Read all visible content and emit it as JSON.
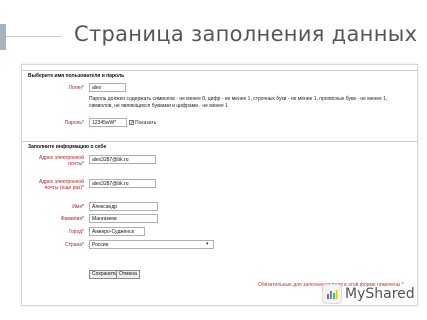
{
  "slide": {
    "title": "Страница заполнения данных"
  },
  "section_login": {
    "legend": "Выберите имя пользователя и пароль",
    "login_label": "Логин",
    "login_value": "alex",
    "hint_lines": [
      "Пароль должен содержать символов - не менее 8, цифр - не менее 1, строчных букв - не менее 1, прописных букв - не менее 1,",
      "символов, не являющихся буквами и цифрами - не менее 1"
    ],
    "password_label": "Пароль",
    "password_value": "12345wW*",
    "show_checkbox_label": "Показать",
    "show_checked": true
  },
  "section_info": {
    "legend": "Заполните информацию о себе",
    "email_label": "Адрес электронной почты",
    "email_value": "alex3287@bk.ru",
    "email_confirm_label": "Адрес электронной почты (еще раз)",
    "email_confirm_value": "alex3287@bk.ru",
    "name_label": "Имя",
    "name_value": "Александр",
    "surname_label": "Фамилия",
    "surname_value": "Мангазеев",
    "city_label": "Город",
    "city_value": "Анжеро-Судженск",
    "country_label": "Страна",
    "country_value": "Россия"
  },
  "buttons": {
    "save": "Сохранить",
    "cancel": "Отмена"
  },
  "required_note": "Обязательные для заполнения поля в этой форме помечены",
  "watermark": {
    "text": "MyShared"
  },
  "colors": {
    "label": "#b32020",
    "required": "#c0392b",
    "title": "#555555",
    "accent_bar": "#a7b4c0"
  }
}
